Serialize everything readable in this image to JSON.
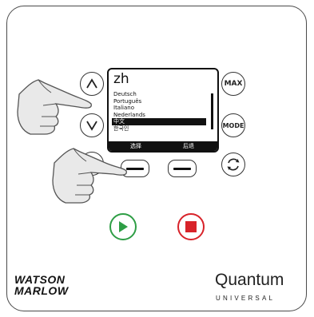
{
  "screen": {
    "language_code": "zh",
    "languages": [
      "Deutsch",
      "Português",
      "Italiano",
      "Nederlands",
      "中文",
      "한국인"
    ],
    "selected_index": 4,
    "softkey_left": "选择",
    "softkey_right": "后退"
  },
  "buttons": {
    "max_label": "MAX",
    "mode_label": "MODE"
  },
  "icons": {
    "up": "chevron-up-icon",
    "down": "chevron-down-icon",
    "refresh": "refresh-icon",
    "run": "play-icon",
    "stop": "stop-icon",
    "hand": "pointing-hand-icon"
  },
  "colors": {
    "run": "#2e9e45",
    "stop": "#d8232a",
    "screen_bg": "#ffffff",
    "screen_ink": "#111111"
  },
  "branding": {
    "left_logo_line1": "WATSON",
    "left_logo_line2": "MARLOW",
    "right_logo": "Quantum",
    "right_logo_sub": "UNIVERSAL"
  }
}
